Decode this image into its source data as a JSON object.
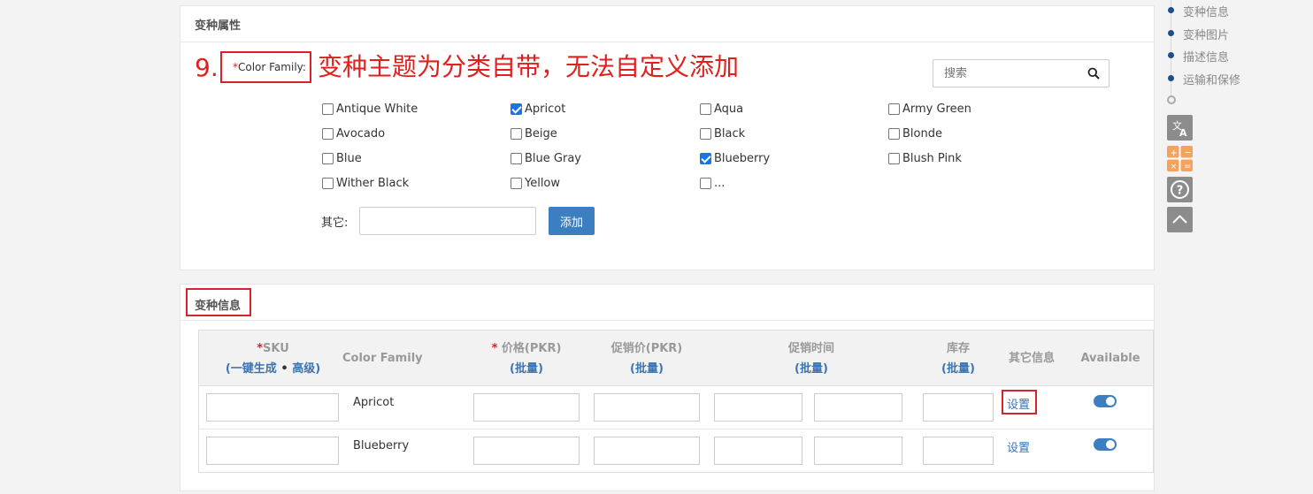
{
  "attr_panel": {
    "title": "变种属性",
    "step_number": "9.",
    "field_required_mark": "*",
    "field_label": "Color Family:",
    "note": "变种主题为分类自带，无法自定义添加",
    "search_placeholder": "搜索",
    "options": [
      {
        "label": "Antique White",
        "checked": false
      },
      {
        "label": "Apricot",
        "checked": true
      },
      {
        "label": "Aqua",
        "checked": false
      },
      {
        "label": "Army Green",
        "checked": false
      },
      {
        "label": "Avocado",
        "checked": false
      },
      {
        "label": "Beige",
        "checked": false
      },
      {
        "label": "Black",
        "checked": false
      },
      {
        "label": "Blonde",
        "checked": false
      },
      {
        "label": "Blue",
        "checked": false
      },
      {
        "label": "Blue Gray",
        "checked": false
      },
      {
        "label": "Blueberry",
        "checked": true
      },
      {
        "label": "Blush Pink",
        "checked": false
      },
      {
        "label": "Wither Black",
        "checked": false
      },
      {
        "label": "Yellow",
        "checked": false
      },
      {
        "label": "...",
        "checked": false
      }
    ],
    "other_label": "其它:",
    "other_value": "",
    "add_button": "添加"
  },
  "variant_panel": {
    "title": "变种信息",
    "headers": {
      "sku": {
        "req": "*",
        "label": "SKU",
        "open": "(",
        "gen": "一键生成",
        "sep": " • ",
        "adv": "高级",
        "close": ")"
      },
      "color_family": "Color Family",
      "price": {
        "req": "* ",
        "label": "价格(PKR)"
      },
      "sale_price": "促销价(PKR)",
      "sale_time": "促销时间",
      "stock": "库存",
      "other_info": "其它信息",
      "available": "Available",
      "batch_open": "(",
      "batch": "批量",
      "batch_close": ")"
    },
    "rows": [
      {
        "sku": "",
        "color": "Apricot",
        "price": "",
        "sale_price": "",
        "sale_start": "",
        "sale_end": "",
        "stock": "",
        "set_label": "设置",
        "available": true
      },
      {
        "sku": "",
        "color": "Blueberry",
        "price": "",
        "sale_price": "",
        "sale_start": "",
        "sale_end": "",
        "stock": "",
        "set_label": "设置",
        "available": true
      }
    ]
  },
  "side_nav": {
    "items": [
      "变种信息",
      "变种图片",
      "描述信息",
      "运输和保修"
    ]
  },
  "colors": {
    "accent": "#3c7fc1",
    "annotation_red": "#e0201c"
  }
}
